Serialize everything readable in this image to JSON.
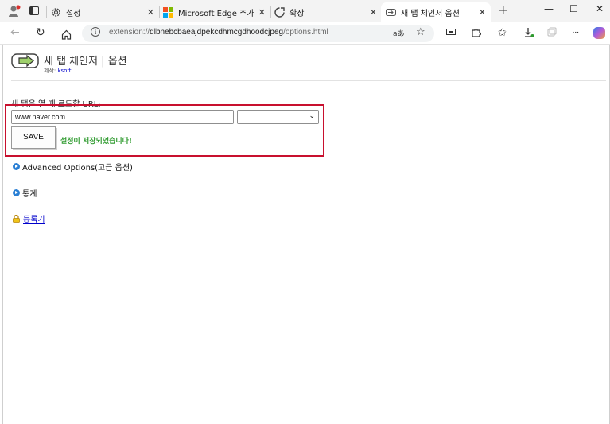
{
  "browser": {
    "tabs": [
      {
        "label": "설정",
        "icon": "gear-icon"
      },
      {
        "label": "Microsoft Edge 추가 기능",
        "icon": "microsoft-logo-icon"
      },
      {
        "label": "확장",
        "icon": "extension-puzzle-icon"
      },
      {
        "label": "새 탭 체인저 옵션",
        "icon": "extension-tab-icon"
      }
    ],
    "new_tab_symbol": "+",
    "window_controls": [
      "—",
      "☐",
      "✕"
    ],
    "address": {
      "prefix": "extension://",
      "host": "dlbnebcbaeajdpekcdhmcgdhoodcjpeg",
      "path": "/options.html"
    },
    "read_aloud_label": "aあ"
  },
  "page": {
    "title": "새 탭 체인저 | 옵션",
    "author_prefix": "제작:",
    "author_link": "ksoft",
    "url_label": "새 탭을 열 때 로드할 URL:",
    "url_value": "www.naver.com",
    "select_value": "",
    "save_label": "SAVE",
    "saved_message": "설정이 저장되었습니다!",
    "advanced_label": "Advanced Options(고급 옵션)",
    "stats_label": "통계",
    "register_label": "등록기"
  },
  "colors": {
    "highlight_box": "#c8102e",
    "success_text": "#2e9a2e",
    "link": "#0000cc"
  }
}
